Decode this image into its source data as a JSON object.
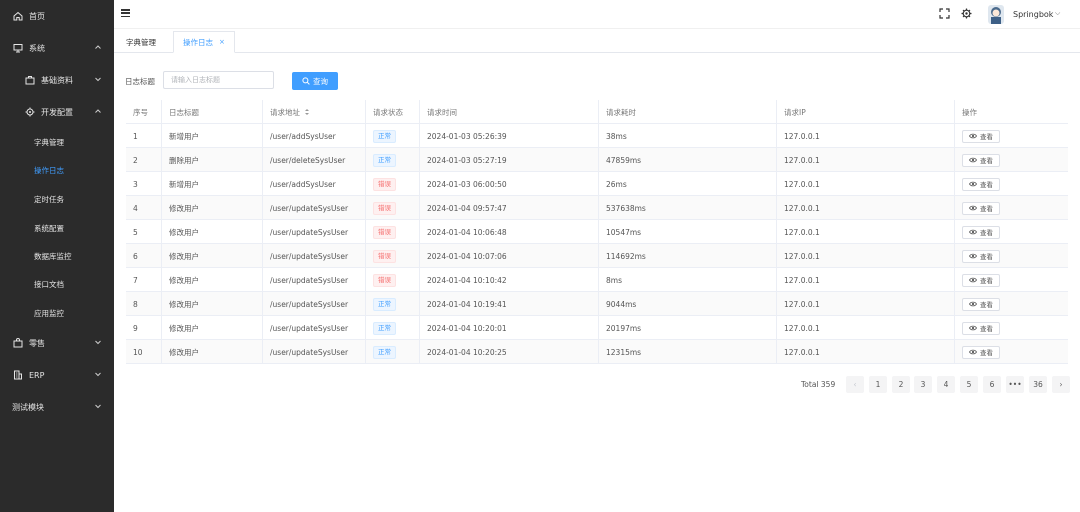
{
  "sidebar": {
    "items": [
      {
        "label": "首页",
        "icon": "home-icon",
        "level": 0
      },
      {
        "label": "系统",
        "icon": "monitor-icon",
        "level": 0,
        "expanded": true
      },
      {
        "label": "基础资料",
        "icon": "briefcase-icon",
        "level": 1,
        "expanded": false
      },
      {
        "label": "开发配置",
        "icon": "gear-icon",
        "level": 1,
        "expanded": true
      },
      {
        "label": "字典管理",
        "level": 2
      },
      {
        "label": "操作日志",
        "level": 2,
        "active": true
      },
      {
        "label": "定时任务",
        "level": 2
      },
      {
        "label": "系统配置",
        "level": 2
      },
      {
        "label": "数据库监控",
        "level": 2
      },
      {
        "label": "接口文档",
        "level": 2
      },
      {
        "label": "应用监控",
        "level": 2
      },
      {
        "label": "零售",
        "icon": "bag-icon",
        "level": 0,
        "expanded": false
      },
      {
        "label": "ERP",
        "icon": "building-icon",
        "level": 0,
        "expanded": false
      },
      {
        "label": "测试模块",
        "level": 0,
        "expanded": false
      }
    ]
  },
  "header": {
    "username": "Springbok"
  },
  "tabs": [
    {
      "label": "字典管理",
      "active": false
    },
    {
      "label": "操作日志",
      "active": true,
      "close": "×"
    }
  ],
  "filter": {
    "label": "日志标题",
    "placeholder": "请输入日志标题",
    "search_label": "查询"
  },
  "table": {
    "columns": [
      "序号",
      "日志标题",
      "请求地址",
      "请求状态",
      "请求时间",
      "请求耗时",
      "请求IP",
      "操作"
    ],
    "view_label": "查看",
    "rows": [
      {
        "no": "1",
        "title": "新增用户",
        "url": "/user/addSysUser",
        "status": "正常",
        "ok": true,
        "time": "2024-01-03 05:26:39",
        "cost": "38ms",
        "ip": "127.0.0.1"
      },
      {
        "no": "2",
        "title": "删除用户",
        "url": "/user/deleteSysUser",
        "status": "正常",
        "ok": true,
        "time": "2024-01-03 05:27:19",
        "cost": "47859ms",
        "ip": "127.0.0.1"
      },
      {
        "no": "3",
        "title": "新增用户",
        "url": "/user/addSysUser",
        "status": "错误",
        "ok": false,
        "time": "2024-01-03 06:00:50",
        "cost": "26ms",
        "ip": "127.0.0.1"
      },
      {
        "no": "4",
        "title": "修改用户",
        "url": "/user/updateSysUser",
        "status": "错误",
        "ok": false,
        "time": "2024-01-04 09:57:47",
        "cost": "537638ms",
        "ip": "127.0.0.1"
      },
      {
        "no": "5",
        "title": "修改用户",
        "url": "/user/updateSysUser",
        "status": "错误",
        "ok": false,
        "time": "2024-01-04 10:06:48",
        "cost": "10547ms",
        "ip": "127.0.0.1"
      },
      {
        "no": "6",
        "title": "修改用户",
        "url": "/user/updateSysUser",
        "status": "错误",
        "ok": false,
        "time": "2024-01-04 10:07:06",
        "cost": "114692ms",
        "ip": "127.0.0.1"
      },
      {
        "no": "7",
        "title": "修改用户",
        "url": "/user/updateSysUser",
        "status": "错误",
        "ok": false,
        "time": "2024-01-04 10:10:42",
        "cost": "8ms",
        "ip": "127.0.0.1"
      },
      {
        "no": "8",
        "title": "修改用户",
        "url": "/user/updateSysUser",
        "status": "正常",
        "ok": true,
        "time": "2024-01-04 10:19:41",
        "cost": "9044ms",
        "ip": "127.0.0.1"
      },
      {
        "no": "9",
        "title": "修改用户",
        "url": "/user/updateSysUser",
        "status": "正常",
        "ok": true,
        "time": "2024-01-04 10:20:01",
        "cost": "20197ms",
        "ip": "127.0.0.1"
      },
      {
        "no": "10",
        "title": "修改用户",
        "url": "/user/updateSysUser",
        "status": "正常",
        "ok": true,
        "time": "2024-01-04 10:20:25",
        "cost": "12315ms",
        "ip": "127.0.0.1"
      }
    ]
  },
  "pagination": {
    "total": "Total 359",
    "prev": "‹",
    "pages": [
      "1",
      "2",
      "3",
      "4",
      "5",
      "6",
      "•••",
      "36"
    ],
    "next": "›",
    "current": "1"
  },
  "colors": {
    "sidebar_bg": "#2b2b2b",
    "accent": "#409eff",
    "error": "#f56c6c"
  }
}
